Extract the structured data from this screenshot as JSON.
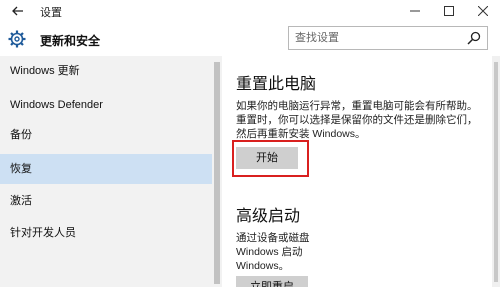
{
  "window": {
    "title": "设置",
    "back_icon": "back-arrow-icon",
    "minimize_icon": "minimize-icon",
    "maximize_icon": "maximize-icon",
    "close_icon": "close-icon"
  },
  "header": {
    "icon": "gear-icon",
    "title": "更新和安全",
    "search_placeholder": "查找设置",
    "search_icon": "search-icon"
  },
  "sidebar": {
    "items": [
      {
        "label": "Windows 更新"
      },
      {
        "label": "Windows Defender"
      },
      {
        "label": "备份"
      },
      {
        "label": "恢复"
      },
      {
        "label": "激活"
      },
      {
        "label": "针对开发人员"
      }
    ],
    "active_index": 3
  },
  "main": {
    "reset": {
      "title": "重置此电脑",
      "line1": "如果你的电脑运行异常，重置电脑可能会有所帮助。",
      "line2": "重置时，你可以选择是保留你的文件还是删除它们，",
      "line3": "然后再重新安装 Windows。",
      "button": "开始"
    },
    "advanced": {
      "title": "高级启动",
      "line1": "通过设备或磁盘",
      "line2": "Windows 启动",
      "line3": "Windows。",
      "button": "立即重启"
    }
  },
  "colors": {
    "sidebar_bg": "#f2f2f2",
    "active_item": "#cde0f3",
    "button_bg": "#cfcfcf",
    "highlight_border": "#d9201f"
  }
}
